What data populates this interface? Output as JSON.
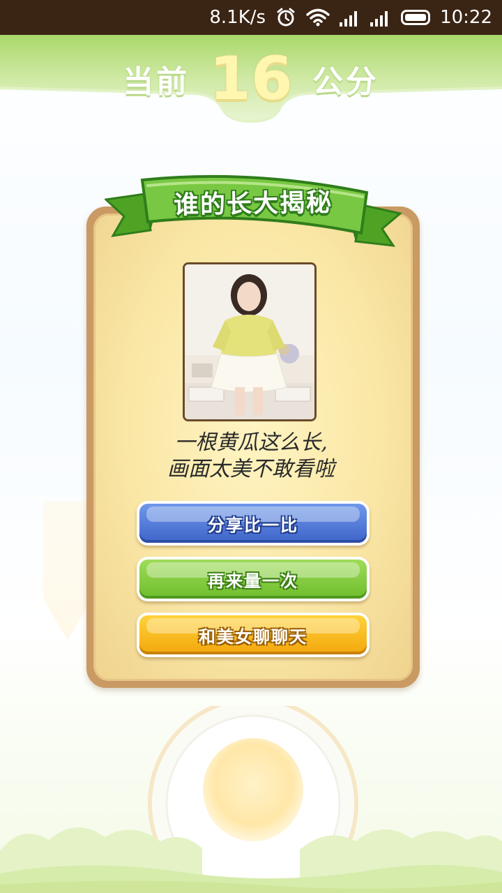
{
  "status_bar": {
    "net_speed": "8.1K/s",
    "time": "10:22",
    "icons": [
      "alarm-icon",
      "wifi-icon",
      "signal-icon",
      "signal-icon",
      "battery-icon"
    ]
  },
  "header": {
    "prefix": "当前",
    "value": "16",
    "unit": "公分"
  },
  "card": {
    "ribbon_title": "谁的长大揭秘",
    "caption_line1": "一根黄瓜这么长,",
    "caption_line2": "画面太美不敢看啦"
  },
  "buttons": {
    "share": "分享比一比",
    "again": "再来量一次",
    "chat": "和美女聊聊天"
  },
  "colors": {
    "status_bar_bg": "#3a2414",
    "header_green": "#bfe28c",
    "ribbon_green": "#6ec23a",
    "card_border": "#c99a63",
    "card_fill": "#fae7a6",
    "share_blue": "#3e64c9",
    "again_green": "#6ebd2c",
    "chat_orange": "#f2a70c"
  }
}
